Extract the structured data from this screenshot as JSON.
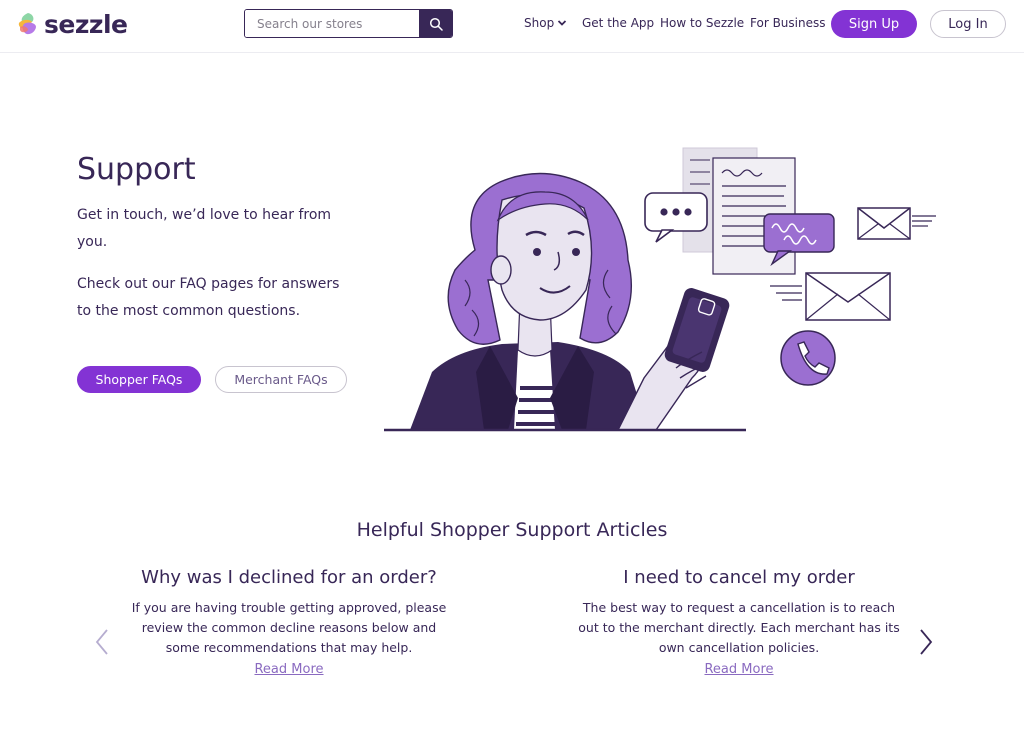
{
  "header": {
    "brand": "sezzle",
    "search_placeholder": "Search our stores",
    "nav": {
      "shop": "Shop",
      "get_app": "Get the App",
      "how_to": "How to Sezzle",
      "for_business": "For Business"
    },
    "signup_label": "Sign Up",
    "login_label": "Log In"
  },
  "hero": {
    "title": "Support",
    "paragraph1": "Get in touch, we’d love to hear from you.",
    "paragraph2": "Check out our FAQ pages for answers to the most common questions.",
    "shopper_faqs": "Shopper FAQs",
    "merchant_faqs": "Merchant FAQs"
  },
  "articles_section": {
    "title": "Helpful Shopper Support Articles",
    "articles": [
      {
        "title": "Why was I declined for an order?",
        "body": "If you are having trouble getting approved, please review the common decline reasons below and some recommendations that may help.",
        "link": "Read More"
      },
      {
        "title": "I need to cancel my order",
        "body": "The best way to request a cancellation is to reach out to the merchant directly. Each merchant has its own cancellation policies.",
        "link": "Read More"
      }
    ]
  },
  "colors": {
    "brand_purple": "#8333d4",
    "dark_navy": "#382757",
    "hair_purple": "#9b6fd1"
  },
  "icons": [
    "search-icon",
    "chevron-down-icon",
    "arrow-left-icon",
    "arrow-right-icon",
    "phone-icon",
    "envelope-icon",
    "chat-bubble-icon"
  ]
}
